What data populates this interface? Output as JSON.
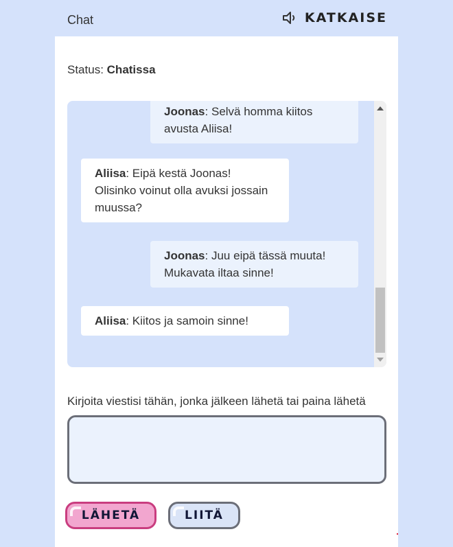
{
  "header": {
    "title": "Chat",
    "end_label": "KATKAISE",
    "end_icon": "speaker-icon"
  },
  "status": {
    "label": "Status:",
    "value": "Chatissa"
  },
  "messages": [
    {
      "sender": "Joonas",
      "text": ": Selvä homma kiitos avusta Aliisa!",
      "role": "user"
    },
    {
      "sender": "Aliisa",
      "text": ": Eipä kestä Joonas! Olisinko voinut olla avuksi jossain muussa?",
      "role": "agent"
    },
    {
      "sender": "Joonas",
      "text": ": Juu eipä tässä muuta! Mukavata iltaa sinne!",
      "role": "user"
    },
    {
      "sender": "Aliisa",
      "text": ": Kiitos ja samoin sinne!",
      "role": "agent"
    }
  ],
  "composer": {
    "prompt": "Kirjoita viestisi tähän, jonka jälkeen lähetä tai paina lähetä",
    "value": "",
    "send_label": "LÄHETÄ",
    "attach_label": "LIITÄ"
  },
  "colors": {
    "page_bg": "#d5e2fb",
    "send_bg": "#f2a6cf",
    "send_border": "#c93d7f",
    "user_bubble": "#ebf2fd",
    "agent_bubble": "#ffffff"
  }
}
